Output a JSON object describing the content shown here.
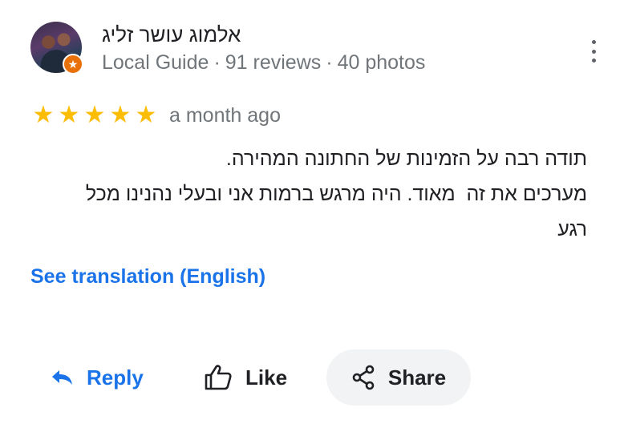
{
  "reviewer": {
    "name": "אלמוג עושר זליג",
    "level": "Local Guide",
    "reviews": "91 reviews",
    "photos": "40 photos",
    "separator": "·"
  },
  "review": {
    "rating": 5,
    "max_rating": 5,
    "time": "a month ago",
    "lines": [
      "תודה רבה על הזמינות של החתונה המהירה.",
      "מערכים את זה  מאוד. היה מרגש ברמות אני ובעלי נהנינו מכל",
      "רגע"
    ],
    "translate_link": "See translation (English)"
  },
  "actions": {
    "reply": "Reply",
    "like": "Like",
    "share": "Share"
  },
  "icons": {
    "more": "more-vert-icon",
    "star": "star-icon",
    "reply": "reply-icon",
    "like": "thumb-up-icon",
    "share": "share-icon",
    "badge": "local-guide-badge-icon"
  },
  "colors": {
    "star": "#fbbc04",
    "link": "#1a73e8",
    "secondary_text": "#70757a",
    "badge": "#e8710a",
    "share_bg": "#f1f3f4"
  }
}
